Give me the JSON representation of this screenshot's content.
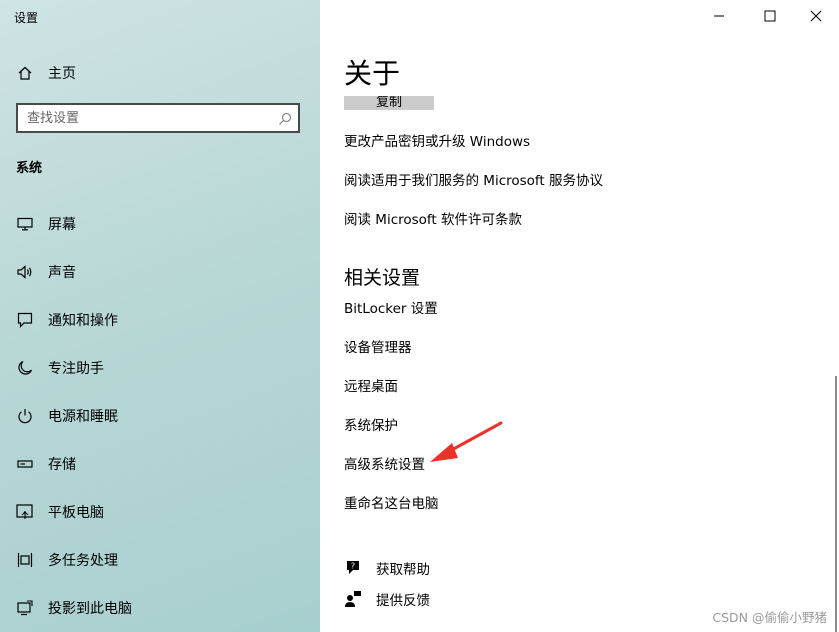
{
  "window": {
    "title": "设置"
  },
  "sidebar": {
    "home_label": "主页",
    "search_placeholder": "查找设置",
    "section_label": "系统",
    "items": [
      {
        "label": "屏幕",
        "icon": "monitor-icon"
      },
      {
        "label": "声音",
        "icon": "speaker-icon"
      },
      {
        "label": "通知和操作",
        "icon": "notification-icon"
      },
      {
        "label": "专注助手",
        "icon": "moon-icon"
      },
      {
        "label": "电源和睡眠",
        "icon": "power-icon"
      },
      {
        "label": "存储",
        "icon": "storage-icon"
      },
      {
        "label": "平板电脑",
        "icon": "tablet-icon"
      },
      {
        "label": "多任务处理",
        "icon": "multitask-icon"
      },
      {
        "label": "投影到此电脑",
        "icon": "project-icon"
      }
    ]
  },
  "main": {
    "title": "关于",
    "copy_button": "复制",
    "links": [
      "更改产品密钥或升级 Windows",
      "阅读适用于我们服务的 Microsoft 服务协议",
      "阅读 Microsoft 软件许可条款"
    ],
    "related_title": "相关设置",
    "related_links": [
      "BitLocker 设置",
      "设备管理器",
      "远程桌面",
      "系统保护",
      "高级系统设置",
      "重命名这台电脑"
    ],
    "help": [
      {
        "label": "获取帮助",
        "icon": "help-icon"
      },
      {
        "label": "提供反馈",
        "icon": "feedback-icon"
      }
    ]
  },
  "watermark": "CSDN @偷偷小野猪",
  "colors": {
    "sidebar_bg": "#b9d8d6",
    "arrow": "#e8322a",
    "text": "#000000"
  }
}
